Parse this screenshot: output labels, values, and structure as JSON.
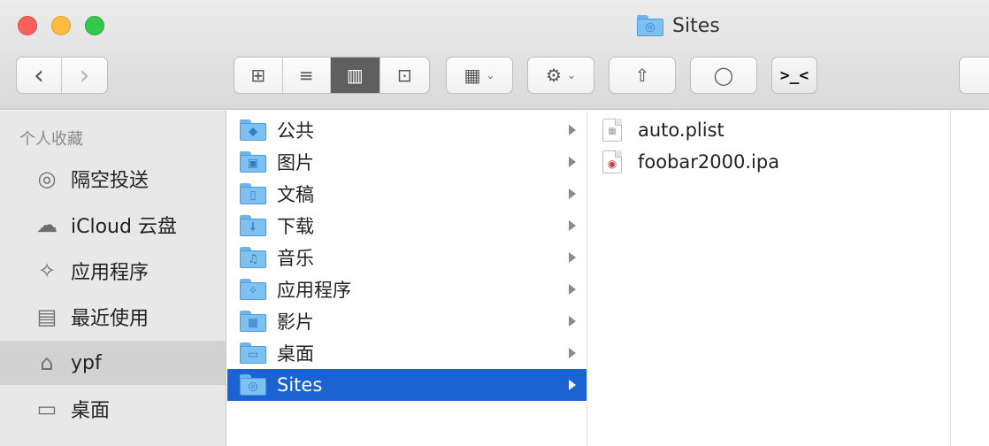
{
  "window": {
    "title": "Sites",
    "title_icon": "sites-folder-icon"
  },
  "toolbar": {
    "back_icon": "‹",
    "forward_icon": "›",
    "view_icons": "⊞",
    "view_list": "≡",
    "view_columns": "▥",
    "view_coverflow": "⊡",
    "group_icon": "▦",
    "action_icon": "⚙",
    "share_icon": "⇧",
    "tag_icon": "◯",
    "terminal_icon": ">_<"
  },
  "sidebar": {
    "header": "个人收藏",
    "items": [
      {
        "label": "隔空投送",
        "icon": "airdrop-icon",
        "glyph": "◎"
      },
      {
        "label": "iCloud 云盘",
        "icon": "cloud-icon",
        "glyph": "☁"
      },
      {
        "label": "应用程序",
        "icon": "applications-icon",
        "glyph": "✧"
      },
      {
        "label": "最近使用",
        "icon": "recents-icon",
        "glyph": "▤"
      },
      {
        "label": "ypf",
        "icon": "home-icon",
        "glyph": "⌂"
      },
      {
        "label": "桌面",
        "icon": "desktop-icon",
        "glyph": "▭"
      }
    ]
  },
  "column1": {
    "items": [
      {
        "label": "公共",
        "glyph": "◆"
      },
      {
        "label": "图片",
        "glyph": "▣"
      },
      {
        "label": "文稿",
        "glyph": "▯"
      },
      {
        "label": "下载",
        "glyph": "↓"
      },
      {
        "label": "音乐",
        "glyph": "♫"
      },
      {
        "label": "应用程序",
        "glyph": "✧"
      },
      {
        "label": "影片",
        "glyph": "▦"
      },
      {
        "label": "桌面",
        "glyph": "▭"
      },
      {
        "label": "Sites",
        "glyph": "◎"
      }
    ],
    "selected_index": 8
  },
  "column2": {
    "items": [
      {
        "label": "auto.plist",
        "icon": "plist-file-icon",
        "glyph": "▦"
      },
      {
        "label": "foobar2000.ipa",
        "icon": "ipa-file-icon",
        "glyph": "◉"
      }
    ]
  },
  "colors": {
    "selection": "#1b62d3",
    "folder": "#7ec0f2"
  }
}
